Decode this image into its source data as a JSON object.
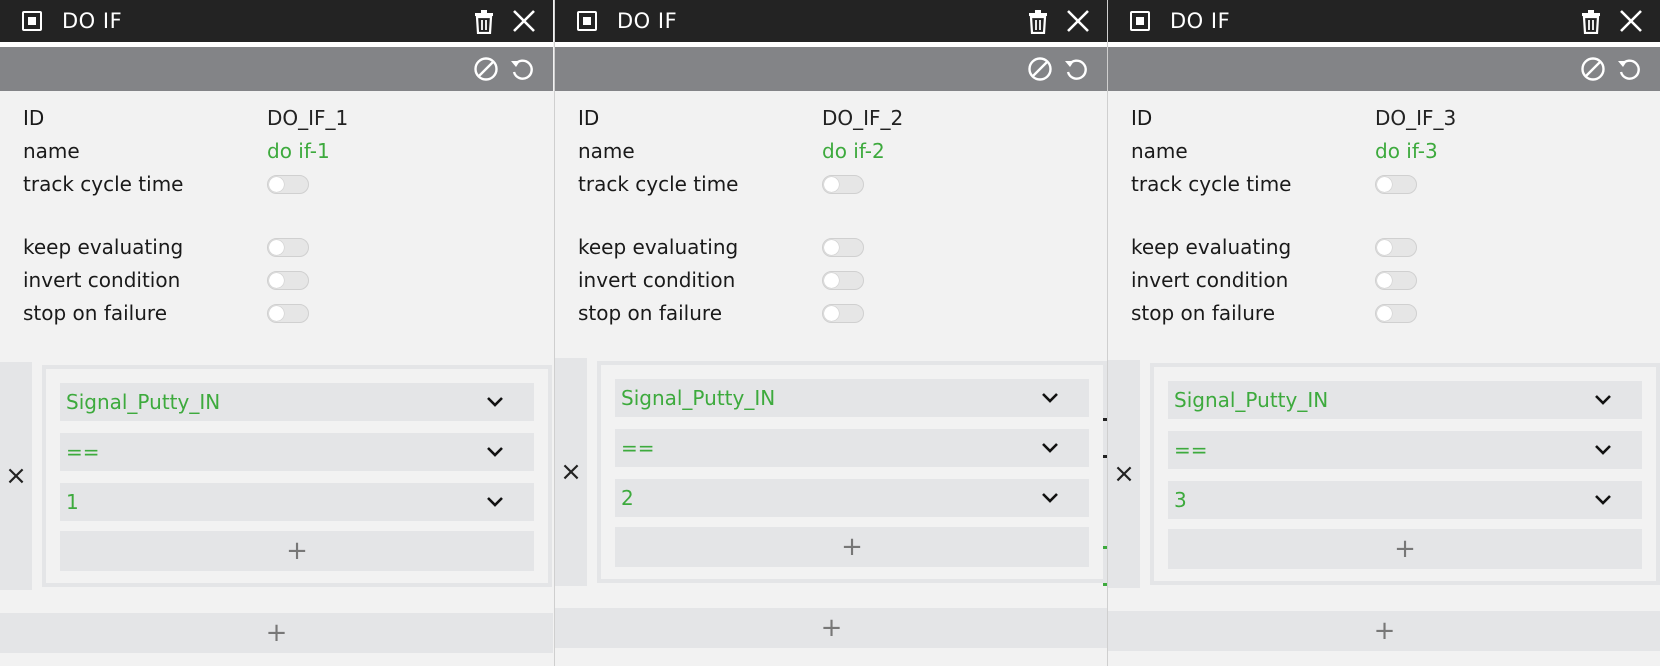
{
  "panels": [
    {
      "title": "DO IF",
      "props": {
        "id_label": "ID",
        "id_value": "DO_IF_1",
        "name_label": "name",
        "name_value": "do if-1",
        "track_label": "track cycle time",
        "keep_label": "keep evaluating",
        "invert_label": "invert condition",
        "stop_label": "stop on failure"
      },
      "condition": {
        "signal": "Signal_Putty_IN",
        "operator": "==",
        "value": "1"
      },
      "add_symbol": "+",
      "remove_symbol": "×"
    },
    {
      "title": "DO IF",
      "props": {
        "id_label": "ID",
        "id_value": "DO_IF_2",
        "name_label": "name",
        "name_value": "do if-2",
        "track_label": "track cycle time",
        "keep_label": "keep evaluating",
        "invert_label": "invert condition",
        "stop_label": "stop on failure"
      },
      "condition": {
        "signal": "Signal_Putty_IN",
        "operator": "==",
        "value": "2"
      },
      "add_symbol": "+",
      "remove_symbol": "×"
    },
    {
      "title": "DO IF",
      "props": {
        "id_label": "ID",
        "id_value": "DO_IF_3",
        "name_label": "name",
        "name_value": "do if-3",
        "track_label": "track cycle time",
        "keep_label": "keep evaluating",
        "invert_label": "invert condition",
        "stop_label": "stop on failure"
      },
      "condition": {
        "signal": "Signal_Putty_IN",
        "operator": "==",
        "value": "3"
      },
      "add_symbol": "+",
      "remove_symbol": "×"
    }
  ],
  "colors": {
    "titlebar": "#232323",
    "toolbar": "#838487",
    "panel_bg": "#f2f2f2",
    "field_bg": "#e4e5e7",
    "accent_green": "#3daa3d"
  },
  "icons": {
    "title": "node-square-icon",
    "delete": "trash-icon",
    "close": "close-icon",
    "disable": "disable-icon",
    "reset": "undo-icon",
    "dropdown": "chevron-down-icon",
    "add": "plus-icon",
    "remove": "x-icon"
  }
}
